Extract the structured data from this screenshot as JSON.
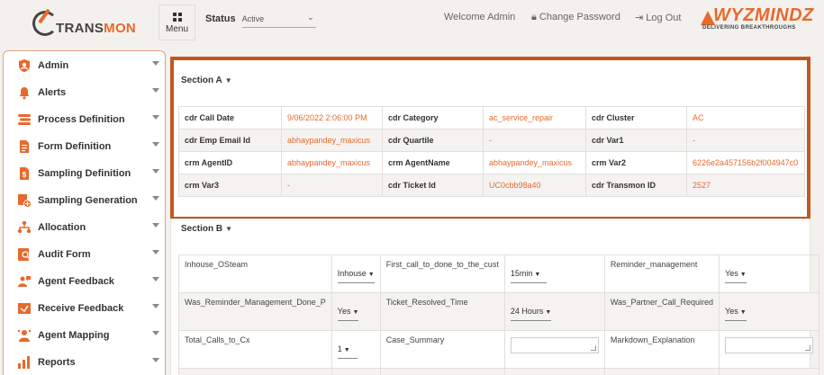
{
  "brand": {
    "logo_text_dark": "TRANS",
    "logo_text_accent": "MON",
    "partner_name": "WYZMINDZ",
    "partner_tagline": "DELIVERING BREAKTHROUGHS"
  },
  "header": {
    "menu_label": "Menu",
    "status_label": "Status",
    "status_value": "Active",
    "welcome": "Welcome Admin",
    "change_password": "Change Password",
    "logout": "Log Out"
  },
  "sidebar": {
    "items": [
      {
        "label": "Admin",
        "icon": "admin-icon"
      },
      {
        "label": "Alerts",
        "icon": "bell-icon"
      },
      {
        "label": "Process Definition",
        "icon": "process-icon"
      },
      {
        "label": "Form Definition",
        "icon": "form-icon"
      },
      {
        "label": "Sampling Definition",
        "icon": "sampling-icon"
      },
      {
        "label": "Sampling Generation",
        "icon": "generation-icon"
      },
      {
        "label": "Allocation",
        "icon": "allocation-icon"
      },
      {
        "label": "Audit Form",
        "icon": "audit-icon"
      },
      {
        "label": "Agent Feedback",
        "icon": "feedback-icon"
      },
      {
        "label": "Receive Feedback",
        "icon": "receive-icon"
      },
      {
        "label": "Agent Mapping",
        "icon": "mapping-icon"
      },
      {
        "label": "Reports",
        "icon": "reports-icon"
      }
    ]
  },
  "section_a": {
    "title": "Section A",
    "rows": [
      [
        {
          "k": "cdr Call Date",
          "v": "9/06/2022 2:06:00 PM"
        },
        {
          "k": "cdr Category",
          "v": "ac_service_repair"
        },
        {
          "k": "cdr Cluster",
          "v": "AC"
        }
      ],
      [
        {
          "k": "cdr Emp Email Id",
          "v": "abhaypandey_maxicus"
        },
        {
          "k": "cdr Quartile",
          "v": "-"
        },
        {
          "k": "cdr Var1",
          "v": "-"
        }
      ],
      [
        {
          "k": "crm AgentID",
          "v": "abhaypandey_maxicus"
        },
        {
          "k": "crm AgentName",
          "v": "abhaypandey_maxicus"
        },
        {
          "k": "crm Var2",
          "v": "6226e2a457156b2f004947c0"
        }
      ],
      [
        {
          "k": "crm Var3",
          "v": "-"
        },
        {
          "k": "cdr Ticket Id",
          "v": "UC0cbb98a40"
        },
        {
          "k": "cdr Transmon ID",
          "v": "2527"
        }
      ]
    ]
  },
  "section_b": {
    "title": "Section B",
    "rows": [
      {
        "c1_label": "Inhouse_OSteam",
        "c1_value": "Inhouse",
        "c2_label": "First_call_to_done_to_the_cust",
        "c2_value": "15min",
        "c3_label": "Reminder_management",
        "c3_value": "Yes"
      },
      {
        "c1_label": "Was_Reminder_Management_Done_P",
        "c1_value": "Yes",
        "c2_label": "Ticket_Resolved_Time",
        "c2_value": "24 Hours",
        "c3_label": "Was_Partner_Call_Required",
        "c3_value": "Yes"
      },
      {
        "c1_label": "Total_Calls_to_Cx",
        "c1_value": "1",
        "c2_label": "Case_Summary",
        "c2_value": "",
        "c3_label": "Markdown_Explanation",
        "c3_value": ""
      }
    ]
  },
  "colors": {
    "accent": "#e8692b",
    "highlight_border": "#c0581e"
  }
}
